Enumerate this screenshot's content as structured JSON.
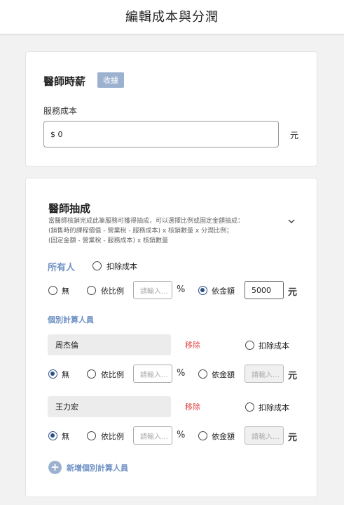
{
  "header": {
    "title": "編輯成本與分潤"
  },
  "salary": {
    "title": "醫師時薪",
    "badge": "收據",
    "cost_label": "服務成本",
    "cost_value": "$ 0",
    "unit": "元"
  },
  "commission": {
    "title": "醫師抽成",
    "desc_line1": "當醫師核銷完成此筆服務可獲得抽成，可以選擇比例或固定金額抽成：",
    "desc_line2": "(銷售時的課程價值 - 營業稅 - 服務成本) x 核銷數量 x 分潤比例；",
    "desc_line3": "(固定金額 - 營業稅 - 服務成本) x 核銷數量",
    "all_label": "所有人",
    "deduct_cost": "扣除成本",
    "opt_none": "無",
    "opt_ratio": "依比例",
    "opt_amount": "依金額",
    "placeholder": "請輸入…",
    "percent": "%",
    "unit": "元",
    "all_amount_value": "5000",
    "all_selected": "amount",
    "individual_label": "個別計算人員",
    "remove_label": "移除",
    "people": [
      {
        "name": "周杰倫",
        "selected": "none"
      },
      {
        "name": "王力宏",
        "selected": "none"
      }
    ],
    "add_label": "新增個別計算人員"
  }
}
